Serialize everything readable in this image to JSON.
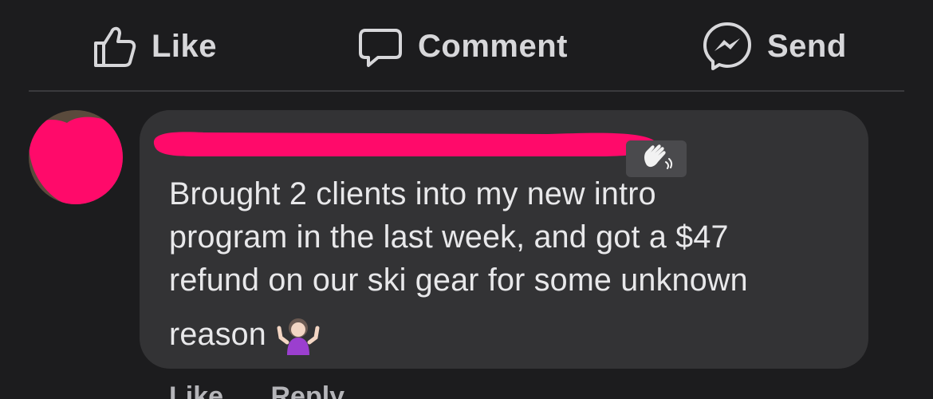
{
  "actions": {
    "like_label": "Like",
    "comment_label": "Comment",
    "send_label": "Send"
  },
  "comment": {
    "text_lines": [
      "Brought 2 clients into my new intro",
      "program in the last week, and got a $47",
      "refund on our ski gear for some unknown"
    ],
    "last_line": "reason",
    "author_badge_icon": "waving-hand-icon",
    "trailing_emoji": "person-shrugging-icon"
  },
  "footer": {
    "like_label": "Like",
    "reply_label": "Reply"
  },
  "colors": {
    "background": "#1c1c1e",
    "bubble": "#333335",
    "redaction": "#ff0a6a",
    "text": "#e8e8ea",
    "action_text": "#d7d7da"
  }
}
